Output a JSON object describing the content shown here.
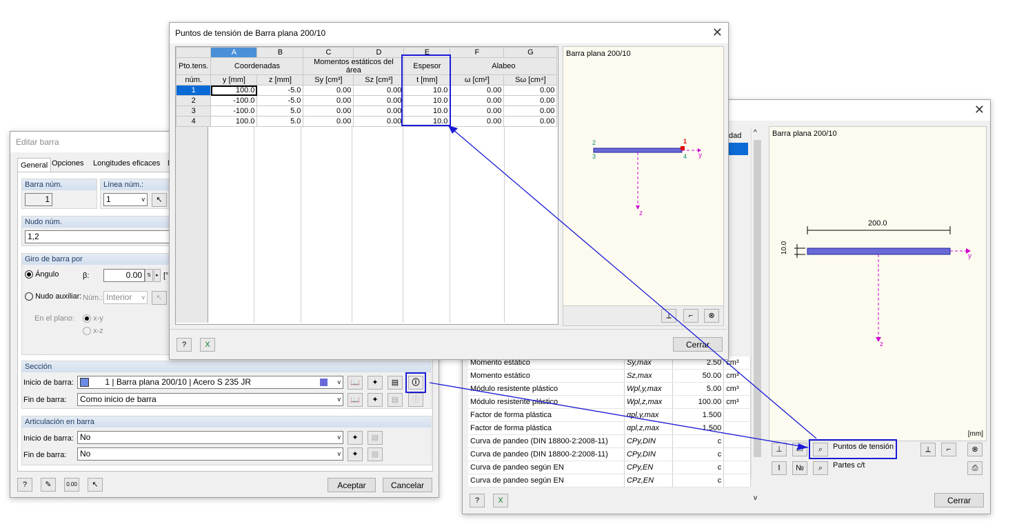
{
  "editar": {
    "title": "Editar barra",
    "tabs": [
      "General",
      "Opciones",
      "Longitudes eficaces",
      "M"
    ],
    "barra_num_label": "Barra núm.",
    "barra_num_value": "1",
    "linea_num_label": "Línea núm.:",
    "linea_num_value": "1",
    "nudo_num_label": "Nudo núm.",
    "nudo_num_value": "1,2",
    "giro_label": "Giro de barra por",
    "angulo_label": "Ángulo",
    "beta_label": "β:",
    "beta_value": "0.00",
    "beta_unit": "[°",
    "nudo_aux_label": "Nudo auxiliar:",
    "num_label": "Núm.:",
    "num_value": "Interior",
    "en_plano_label": "En el plano:",
    "plane_xy": "x-y",
    "plane_xz": "x-z",
    "seccion_label": "Sección",
    "inicio_label": "Inicio de barra:",
    "inicio_value_num": "1",
    "inicio_value_name": "Barra plana 200/10",
    "inicio_value_mat": "Acero S 235 JR",
    "fin_label": "Fin de barra:",
    "fin_value": "Como inicio de barra",
    "artic_label": "Articulación en barra",
    "artic_inicio_label": "Inicio de barra:",
    "artic_inicio_value": "No",
    "artic_fin_label": "Fin de barra:",
    "artic_fin_value": "No",
    "aceptar": "Aceptar",
    "cancelar": "Cancelar",
    "units_icon_text": "0.00"
  },
  "tension": {
    "title": "Puntos de tensión de Barra plana 200/10",
    "col_letters": [
      "A",
      "B",
      "C",
      "D",
      "E",
      "F",
      "G"
    ],
    "rowhdr_1": "Pto.tens.",
    "rowhdr_2": "núm.",
    "group_coord": "Coordenadas",
    "group_mom": "Momentos estáticos del área",
    "group_esp": "Espesor",
    "group_alabeo": "Alabeo",
    "sub_headers": [
      "y [mm]",
      "z [mm]",
      "Sy [cm³]",
      "Sz [cm³]",
      "t [mm]",
      "ω [cm²]",
      "Sω [cm⁴]"
    ],
    "rows": [
      {
        "n": "1",
        "y": "100.0",
        "z": "-5.0",
        "sy": "0.00",
        "sz": "0.00",
        "t": "10.0",
        "w": "0.00",
        "sw": "0.00"
      },
      {
        "n": "2",
        "y": "-100.0",
        "z": "-5.0",
        "sy": "0.00",
        "sz": "0.00",
        "t": "10.0",
        "w": "0.00",
        "sw": "0.00"
      },
      {
        "n": "3",
        "y": "-100.0",
        "z": "5.0",
        "sy": "0.00",
        "sz": "0.00",
        "t": "10.0",
        "w": "0.00",
        "sw": "0.00"
      },
      {
        "n": "4",
        "y": "100.0",
        "z": "5.0",
        "sy": "0.00",
        "sz": "0.00",
        "t": "10.0",
        "w": "0.00",
        "sw": "0.00"
      }
    ],
    "preview_title": "Barra plana 200/10",
    "preview_y": "y",
    "preview_z": "z",
    "pt1": "1",
    "pt2": "2",
    "pt3": "3",
    "pt4": "4",
    "cerrar": "Cerrar"
  },
  "props": {
    "header_partial": "dad",
    "rows": [
      {
        "name": "Momento estático",
        "sym": "Sy,max",
        "val": "2.50",
        "unit": "cm³"
      },
      {
        "name": "Momento estático",
        "sym": "Sz,max",
        "val": "50.00",
        "unit": "cm³"
      },
      {
        "name": "Módulo resistente plástico",
        "sym": "Wpl,y,max",
        "val": "5.00",
        "unit": "cm³"
      },
      {
        "name": "Módulo resistente plástico",
        "sym": "Wpl,z,max",
        "val": "100.00",
        "unit": "cm³"
      },
      {
        "name": "Factor de forma plástica",
        "sym": "αpl,y,max",
        "val": "1.500",
        "unit": ""
      },
      {
        "name": "Factor de forma plástica",
        "sym": "αpl,z,max",
        "val": "1.500",
        "unit": ""
      },
      {
        "name": "Curva de pandeo (DIN 18800-2:2008-11)",
        "sym": "CPy,DIN",
        "val": "c",
        "unit": ""
      },
      {
        "name": "Curva de pandeo (DIN 18800-2:2008-11)",
        "sym": "CPy,DIN",
        "val": "c",
        "unit": ""
      },
      {
        "name": "Curva de pandeo según EN",
        "sym": "CPy,EN",
        "val": "c",
        "unit": ""
      },
      {
        "name": "Curva de pandeo según EN",
        "sym": "CPz,EN",
        "val": "c",
        "unit": ""
      }
    ],
    "preview_title": "Barra plana 200/10",
    "dim_width": "200.0",
    "dim_thick": "10.0",
    "axis_y": "y",
    "axis_z": "z",
    "unit_mm": "[mm]",
    "puntos_label": "Puntos de tensión",
    "partes_label": "Partes c/t",
    "cerrar": "Cerrar"
  },
  "colors": {
    "accent": "#1a1ad6",
    "section_fill": "#6a6ad6",
    "axis_magenta": "#d000d0",
    "preview_bg": "#fdfaf0",
    "row_select": "#0a6bd6"
  }
}
